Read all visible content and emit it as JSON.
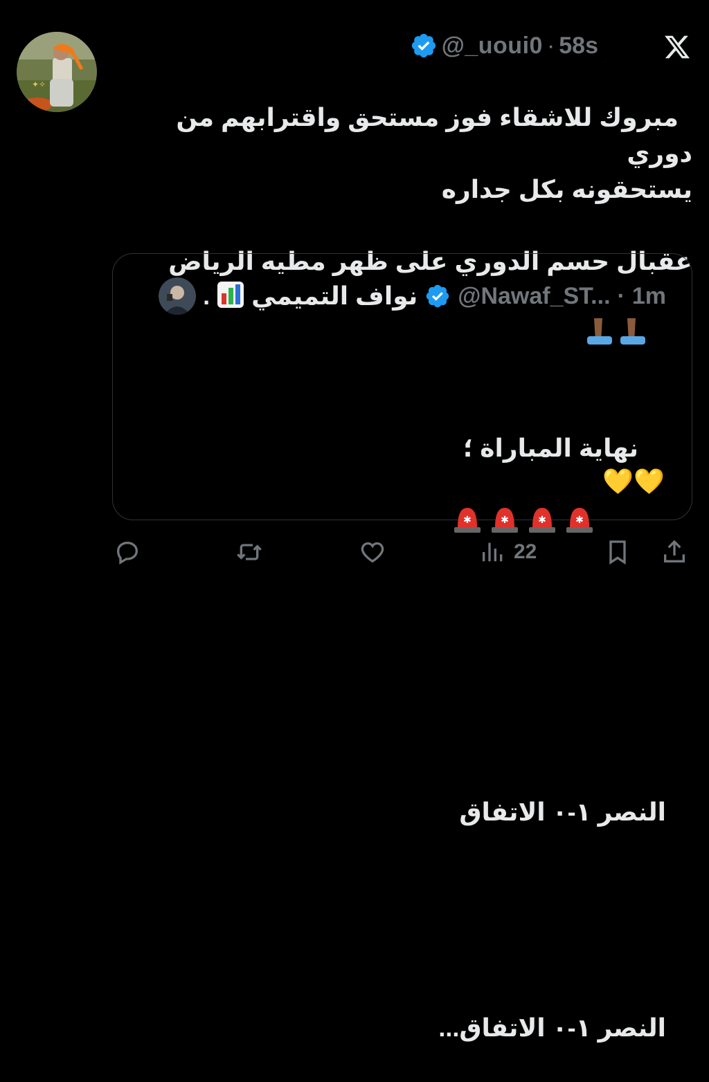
{
  "tweet": {
    "handle": "@_uoui0",
    "separator": "·",
    "time": "58s",
    "text": "مبروك للاشقاء فوز مستحق واقترابهم من دوري\nيستحقونه بكل جداره\n\nعقبال حسم الدوري على ظهر مطيه الرياض",
    "emoji_line2": "💛💛"
  },
  "quote": {
    "name": "نواف التميمي",
    "name_suffix": ".",
    "handle": "@Nawaf_ST...",
    "separator": "·",
    "time": "1m",
    "line1": "نهاية المباراة ؛",
    "line2": "النصر ١-٠ الاتفاق",
    "line3": "النصر ١-٠ الاتفاق..."
  },
  "actions": {
    "views": "22"
  },
  "colors": {
    "background": "#000000",
    "text": "#e7e9ea",
    "muted": "#71767b",
    "verified": "#1d9bf0",
    "border": "#2f3336"
  },
  "icons": [
    "verified-badge-icon",
    "x-logo-icon",
    "reply-icon",
    "repost-icon",
    "like-icon",
    "views-icon",
    "bookmark-icon",
    "share-icon",
    "bar-chart-emoji",
    "siren-emoji",
    "praying-hands-emoji",
    "yellow-heart-emoji"
  ]
}
